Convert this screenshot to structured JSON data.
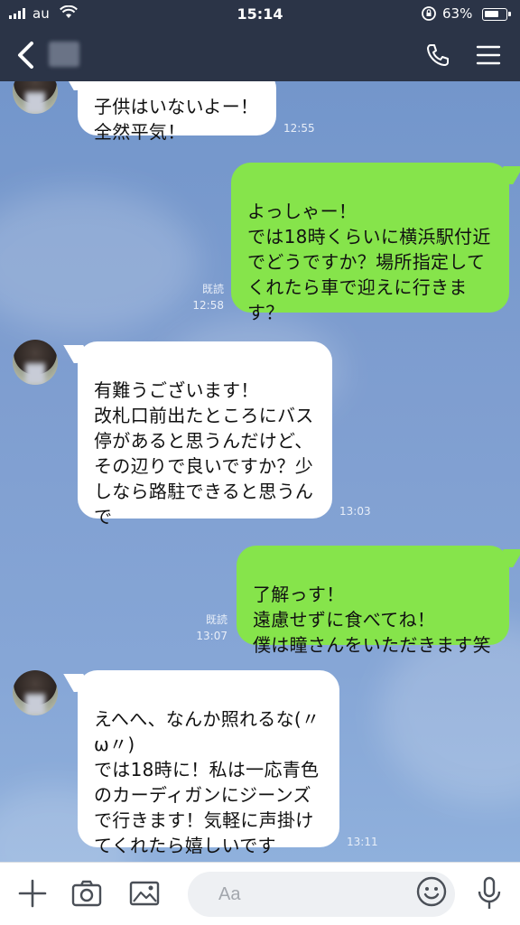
{
  "status_bar": {
    "carrier": "au",
    "time": "15:14",
    "battery": "63%"
  },
  "header": {
    "back_icon": "chevron-left-icon",
    "call_icon": "phone-icon",
    "menu_icon": "hamburger-menu-icon"
  },
  "messages": [
    {
      "side": "in",
      "text": "子供はいないよー！\n全然平気！",
      "time": "12:55",
      "read": ""
    },
    {
      "side": "out",
      "text": "よっしゃー！\nでは18時くらいに横浜駅付近\nでどうですか？場所指定して\nくれたら車で迎えに行きま\nす？",
      "time": "12:58",
      "read": "既読"
    },
    {
      "side": "in",
      "text": "有難うございます！\n改札口前出たところにバス\n停があると思うんだけど、\nその辺りで良いですか？少\nしなら路駐できると思うん\nで",
      "time": "13:03",
      "read": ""
    },
    {
      "side": "out",
      "text": "了解っす！\n遠慮せずに食べてね！\n僕は瞳さんをいただきます笑",
      "time": "13:07",
      "read": "既読"
    },
    {
      "side": "in",
      "text": "えへへ、なんか照れるな(〃\nω〃)\nでは18時に！私は一応青色\nのカーディガンにジーンズ\nで行きます！気軽に声掛け\nてくれたら嬉しいです",
      "time": "13:11",
      "read": ""
    }
  ],
  "input": {
    "placeholder": "Aa"
  },
  "colors": {
    "header": "#2b3447",
    "outgoing_bubble": "#86e44b",
    "incoming_bubble": "#ffffff",
    "background": "#7f9cc9"
  }
}
